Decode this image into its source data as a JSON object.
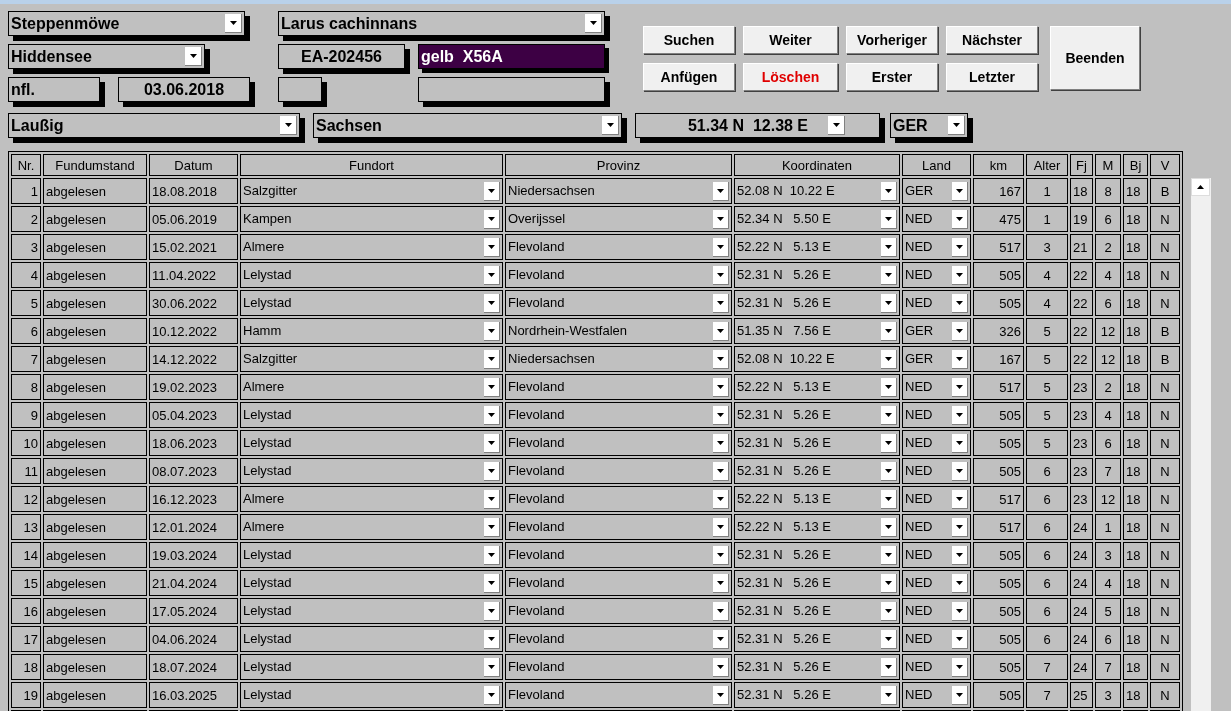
{
  "record": {
    "species": "Steppenmöwe",
    "latin": "Larus cachinnans",
    "place": "Hiddensee",
    "ring": "EA-202456",
    "color_ring": "gelb  X56A",
    "status": "nfl.",
    "date": "03.06.2018",
    "locality": "Laußig",
    "state": "Sachsen",
    "coordinates": "51.34 N  12.38 E",
    "country": "GER"
  },
  "buttons": [
    {
      "label": "Suchen",
      "kind": "normal"
    },
    {
      "label": "Weiter",
      "kind": "normal"
    },
    {
      "label": "Vorheriger",
      "kind": "normal"
    },
    {
      "label": "Nächster",
      "kind": "normal"
    },
    {
      "label": "Anfügen",
      "kind": "normal"
    },
    {
      "label": "Löschen",
      "kind": "danger"
    },
    {
      "label": "Erster",
      "kind": "normal"
    },
    {
      "label": "Letzter",
      "kind": "normal"
    }
  ],
  "exit_button": "Beenden",
  "table": {
    "columns": [
      "Nr.",
      "Fundumstand",
      "Datum",
      "Fundort",
      "Provinz",
      "Koordinaten",
      "Land",
      "km",
      "Alter",
      "Fj",
      "M",
      "Bj",
      "V"
    ],
    "rows": [
      [
        "1",
        "abgelesen",
        "18.08.2018",
        "Salzgitter",
        "Niedersachsen",
        "52.08 N  10.22 E",
        "GER",
        "167",
        "1",
        "18",
        "8",
        "18",
        "B"
      ],
      [
        "2",
        "abgelesen",
        "05.06.2019",
        "Kampen",
        "Overijssel",
        "52.34 N   5.50 E",
        "NED",
        "475",
        "1",
        "19",
        "6",
        "18",
        "N"
      ],
      [
        "3",
        "abgelesen",
        "15.02.2021",
        "Almere",
        "Flevoland",
        "52.22 N   5.13 E",
        "NED",
        "517",
        "3",
        "21",
        "2",
        "18",
        "N"
      ],
      [
        "4",
        "abgelesen",
        "11.04.2022",
        "Lelystad",
        "Flevoland",
        "52.31 N   5.26 E",
        "NED",
        "505",
        "4",
        "22",
        "4",
        "18",
        "N"
      ],
      [
        "5",
        "abgelesen",
        "30.06.2022",
        "Lelystad",
        "Flevoland",
        "52.31 N   5.26 E",
        "NED",
        "505",
        "4",
        "22",
        "6",
        "18",
        "N"
      ],
      [
        "6",
        "abgelesen",
        "10.12.2022",
        "Hamm",
        "Nordrhein-Westfalen",
        "51.35 N   7.56 E",
        "GER",
        "326",
        "5",
        "22",
        "12",
        "18",
        "B"
      ],
      [
        "7",
        "abgelesen",
        "14.12.2022",
        "Salzgitter",
        "Niedersachsen",
        "52.08 N  10.22 E",
        "GER",
        "167",
        "5",
        "22",
        "12",
        "18",
        "B"
      ],
      [
        "8",
        "abgelesen",
        "19.02.2023",
        "Almere",
        "Flevoland",
        "52.22 N   5.13 E",
        "NED",
        "517",
        "5",
        "23",
        "2",
        "18",
        "N"
      ],
      [
        "9",
        "abgelesen",
        "05.04.2023",
        "Lelystad",
        "Flevoland",
        "52.31 N   5.26 E",
        "NED",
        "505",
        "5",
        "23",
        "4",
        "18",
        "N"
      ],
      [
        "10",
        "abgelesen",
        "18.06.2023",
        "Lelystad",
        "Flevoland",
        "52.31 N   5.26 E",
        "NED",
        "505",
        "5",
        "23",
        "6",
        "18",
        "N"
      ],
      [
        "11",
        "abgelesen",
        "08.07.2023",
        "Lelystad",
        "Flevoland",
        "52.31 N   5.26 E",
        "NED",
        "505",
        "6",
        "23",
        "7",
        "18",
        "N"
      ],
      [
        "12",
        "abgelesen",
        "16.12.2023",
        "Almere",
        "Flevoland",
        "52.22 N   5.13 E",
        "NED",
        "517",
        "6",
        "23",
        "12",
        "18",
        "N"
      ],
      [
        "13",
        "abgelesen",
        "12.01.2024",
        "Almere",
        "Flevoland",
        "52.22 N   5.13 E",
        "NED",
        "517",
        "6",
        "24",
        "1",
        "18",
        "N"
      ],
      [
        "14",
        "abgelesen",
        "19.03.2024",
        "Lelystad",
        "Flevoland",
        "52.31 N   5.26 E",
        "NED",
        "505",
        "6",
        "24",
        "3",
        "18",
        "N"
      ],
      [
        "15",
        "abgelesen",
        "21.04.2024",
        "Lelystad",
        "Flevoland",
        "52.31 N   5.26 E",
        "NED",
        "505",
        "6",
        "24",
        "4",
        "18",
        "N"
      ],
      [
        "16",
        "abgelesen",
        "17.05.2024",
        "Lelystad",
        "Flevoland",
        "52.31 N   5.26 E",
        "NED",
        "505",
        "6",
        "24",
        "5",
        "18",
        "N"
      ],
      [
        "17",
        "abgelesen",
        "04.06.2024",
        "Lelystad",
        "Flevoland",
        "52.31 N   5.26 E",
        "NED",
        "505",
        "6",
        "24",
        "6",
        "18",
        "N"
      ],
      [
        "18",
        "abgelesen",
        "18.07.2024",
        "Lelystad",
        "Flevoland",
        "52.31 N   5.26 E",
        "NED",
        "505",
        "7",
        "24",
        "7",
        "18",
        "N"
      ],
      [
        "19",
        "abgelesen",
        "16.03.2025",
        "Lelystad",
        "Flevoland",
        "52.31 N   5.26 E",
        "NED",
        "505",
        "7",
        "25",
        "3",
        "18",
        "N"
      ]
    ]
  }
}
